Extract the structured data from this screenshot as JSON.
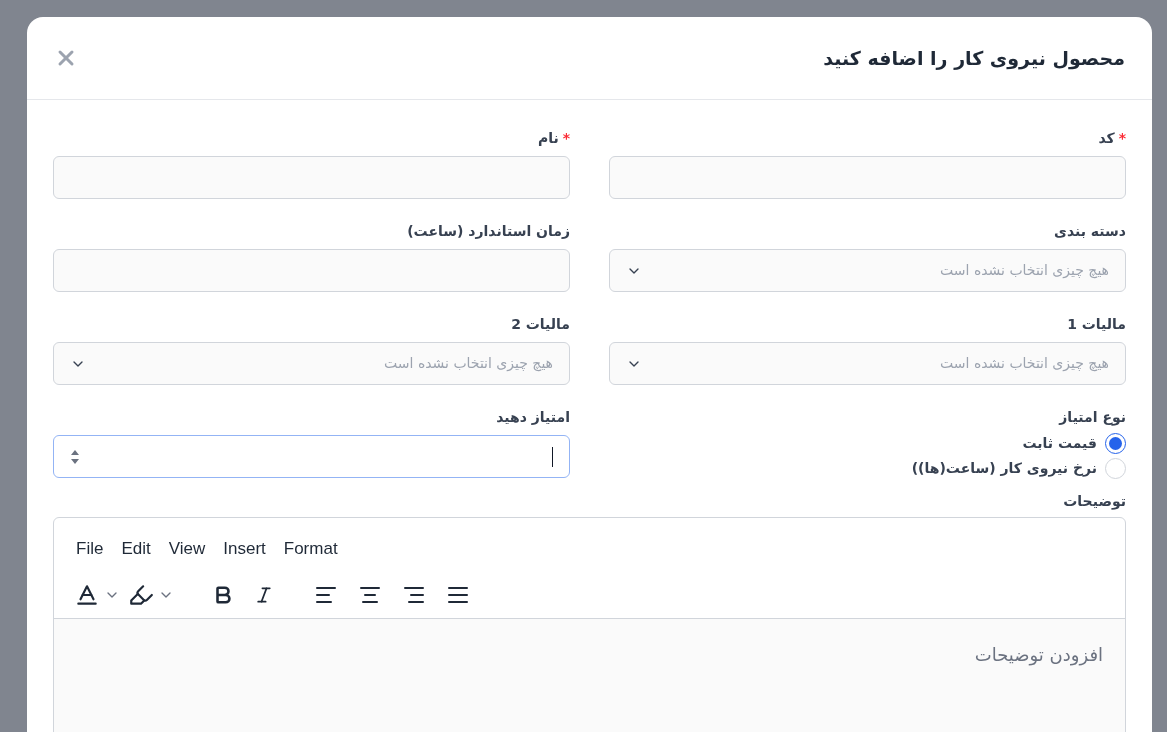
{
  "dialog": {
    "title": "محصول نیروی کار را اضافه کنید"
  },
  "fields": [
    {
      "kind": "text",
      "label": "کد",
      "required_mark": "*"
    },
    {
      "kind": "text",
      "label": "نام",
      "required_mark": "*"
    },
    {
      "kind": "select",
      "label": "دسته بندی",
      "placeholder": "هیچ چیزی انتخاب نشده است"
    },
    {
      "kind": "text",
      "label": "زمان استاندارد (ساعت)"
    },
    {
      "kind": "select",
      "label": "مالیات 1",
      "placeholder": "هیچ چیزی انتخاب نشده است"
    },
    {
      "kind": "select",
      "label": "مالیات 2",
      "placeholder": "هیچ چیزی انتخاب نشده است"
    },
    {
      "kind": "radio",
      "label": "نوع امتیاز",
      "options": [
        {
          "label": "قیمت ثابت",
          "selected": true
        },
        {
          "label": "نرخ نیروی کار (ساعت(ها))",
          "selected": false
        }
      ]
    },
    {
      "kind": "number",
      "label": "امتیاز دهید",
      "focused": true
    }
  ],
  "description": {
    "label": "توضیحات",
    "menu": {
      "file": "File",
      "edit": "Edit",
      "view": "View",
      "insert": "Insert",
      "format": "Format"
    },
    "placeholder": "افزودن توضیحات"
  }
}
